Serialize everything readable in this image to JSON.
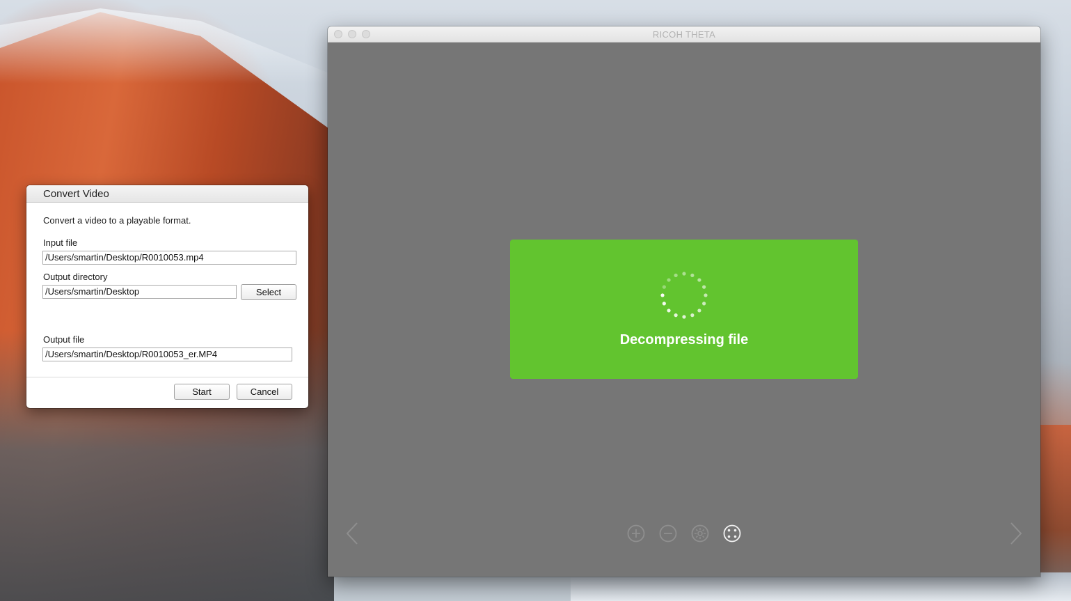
{
  "theta_window": {
    "title": "RICOH THETA",
    "progress_label": "Decompressing file"
  },
  "convert_dialog": {
    "title": "Convert Video",
    "description": "Convert a video to a playable format.",
    "input_label": "Input file",
    "input_value": "/Users/smartin/Desktop/R0010053.mp4",
    "output_dir_label": "Output directory",
    "output_dir_value": "/Users/smartin/Desktop",
    "select_label": "Select",
    "output_file_label": "Output file",
    "output_file_value": "/Users/smartin/Desktop/R0010053_er.MP4",
    "start_label": "Start",
    "cancel_label": "Cancel"
  },
  "icons": {
    "toolbar": [
      "zoom-in-icon",
      "zoom-out-icon",
      "rotate-icon",
      "fullscreen-icon"
    ],
    "nav": [
      "chevron-left-icon",
      "chevron-right-icon"
    ]
  },
  "colors": {
    "progress_panel": "#62c42f",
    "viewer_background": "#767676"
  }
}
